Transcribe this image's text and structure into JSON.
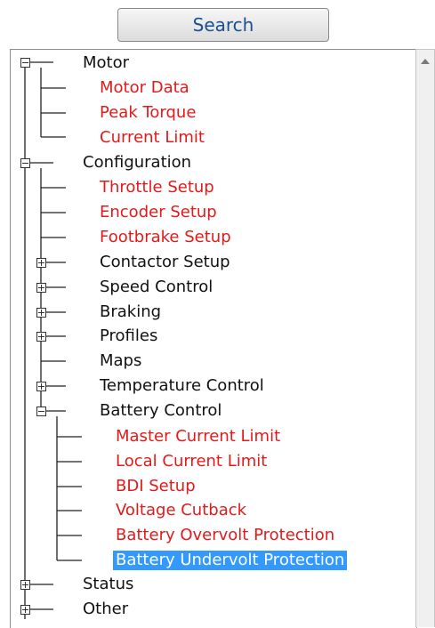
{
  "search": {
    "label": "Search"
  },
  "tree": {
    "motor": {
      "label": "Motor",
      "children": [
        "Motor Data",
        "Peak Torque",
        "Current Limit"
      ]
    },
    "configuration": {
      "label": "Configuration",
      "children": [
        "Throttle Setup",
        "Encoder Setup",
        "Footbrake Setup",
        "Contactor Setup",
        "Speed Control",
        "Braking",
        "Profiles",
        "Maps",
        "Temperature Control",
        "Battery Control"
      ]
    },
    "battery_control": {
      "children": [
        "Master Current Limit",
        "Local Current Limit",
        "BDI Setup",
        "Voltage Cutback",
        "Battery Overvolt Protection",
        "Battery Undervolt Protection"
      ]
    },
    "status": {
      "label": "Status"
    },
    "other": {
      "label": "Other"
    }
  },
  "colors": {
    "config_item": "#e21a1a",
    "category": "#111111",
    "selection": "#3399ff"
  }
}
